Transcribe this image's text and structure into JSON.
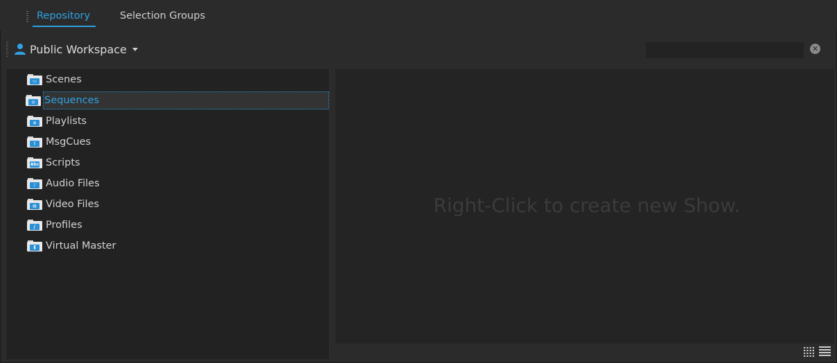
{
  "tabs": [
    {
      "label": "Repository",
      "active": true
    },
    {
      "label": "Selection Groups",
      "active": false
    }
  ],
  "workspace": {
    "label": "Public Workspace",
    "search_value": "",
    "icon": "user-icon"
  },
  "tree": {
    "items": [
      {
        "label": "Scenes",
        "icon": "scenes-folder-icon",
        "glyph": "▭"
      },
      {
        "label": "Sequences",
        "icon": "sequences-folder-icon",
        "glyph": "◎",
        "selected": true
      },
      {
        "label": "Playlists",
        "icon": "playlists-folder-icon",
        "glyph": "≡"
      },
      {
        "label": "MsgCues",
        "icon": "msgcues-folder-icon",
        "glyph": "!"
      },
      {
        "label": "Scripts",
        "icon": "scripts-folder-icon",
        "glyph": "Abc"
      },
      {
        "label": "Audio Files",
        "icon": "audio-folder-icon",
        "glyph": "♪"
      },
      {
        "label": "Video Files",
        "icon": "video-folder-icon",
        "glyph": "▤"
      },
      {
        "label": "Profiles",
        "icon": "profiles-folder-icon",
        "glyph": "∫"
      },
      {
        "label": "Virtual Master",
        "icon": "virtual-master-folder-icon",
        "glyph": "⫼"
      }
    ]
  },
  "detail": {
    "empty_message": "Right-Click to create new Show."
  },
  "colors": {
    "accent": "#2fa3e6",
    "background": "#2b2b2b",
    "panel": "#222222"
  }
}
